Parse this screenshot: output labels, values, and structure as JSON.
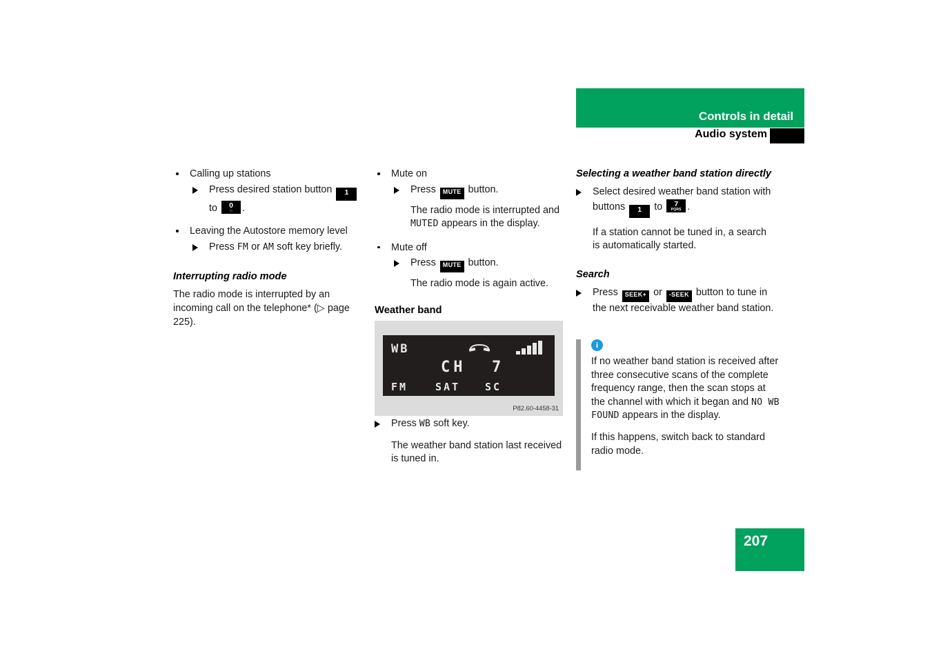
{
  "header": {
    "chapter": "Controls in detail",
    "section": "Audio system"
  },
  "page_number": "207",
  "left_column": {
    "item1_label": "Calling up stations",
    "item1_step_pre": "Press desired station button",
    "item1_step_mid": "to",
    "item1_step_end": ".",
    "item1_key_from": "1",
    "item1_key_to": "0",
    "item2_label": "Leaving the Autostore memory level",
    "item2_step_pre": "Press",
    "item2_key_fm": "FM",
    "item2_step_or": "or",
    "item2_key_am": "AM",
    "item2_step_post": "soft key briefly.",
    "heading": "Interrupting radio mode",
    "paragraph": "The radio mode is interrupted by an incoming call on the telephone* (▷ page 225)."
  },
  "mid_column": {
    "mute_on_label": "Mute on",
    "mute_on_step_pre": "Press",
    "mute_key": "MUTE",
    "mute_on_step_post": "button.",
    "mute_on_result_pre": "The radio mode is interrupted and",
    "mute_on_result_mono": "MUTED",
    "mute_on_result_post": "appears in the display.",
    "mute_off_label": "Mute off",
    "mute_off_step_pre": "Press",
    "mute_off_step_post": "button.",
    "mute_off_result": "The radio mode is again active.",
    "weather_band_heading": "Weather band",
    "figure": {
      "display_band": "WB",
      "display_channel_label": "CH",
      "display_channel_number": "7",
      "display_softkey_1": "FM",
      "display_softkey_2": "SAT",
      "display_softkey_3": "SC",
      "phone_icon": "phone-icon",
      "signal_icon": "signal-bars-icon",
      "caption": "P82.60-4458-31"
    },
    "after_figure_step_pre": "Press",
    "after_figure_key": "WB",
    "after_figure_step_post": "soft key.",
    "after_figure_result": "The weather band station last received is tuned in."
  },
  "right_column": {
    "heading_select": "Selecting a weather band station directly",
    "select_step_pre": "Select desired weather band station with buttons",
    "select_step_mid": "to",
    "select_step_end": ".",
    "select_key_from": "1",
    "select_key_to_main": "7",
    "select_key_to_sub": "PQRS",
    "select_result": "If a station cannot be tuned in, a search is automatically started.",
    "heading_search": "Search",
    "search_step_pre": "Press",
    "search_key_plus": "SEEK+",
    "search_step_or": "or",
    "search_key_minus": "-SEEK",
    "search_step_post": "button to tune in the next receivable weather band station.",
    "note": {
      "icon": "info-icon",
      "paragraph1_pre": "If no weather band station is received after three consecutive scans of the complete frequency range, then the scan stops at the channel with which it began and",
      "paragraph1_mono": "NO WB FOUND",
      "paragraph1_post": "appears in the display.",
      "paragraph2": "If this happens, switch back to standard radio mode."
    }
  },
  "colors": {
    "brand_green": "#00a25e",
    "note_bar_gray": "#9a9a9a",
    "info_blue": "#1b9ae0",
    "display_bg": "#221e1e"
  }
}
